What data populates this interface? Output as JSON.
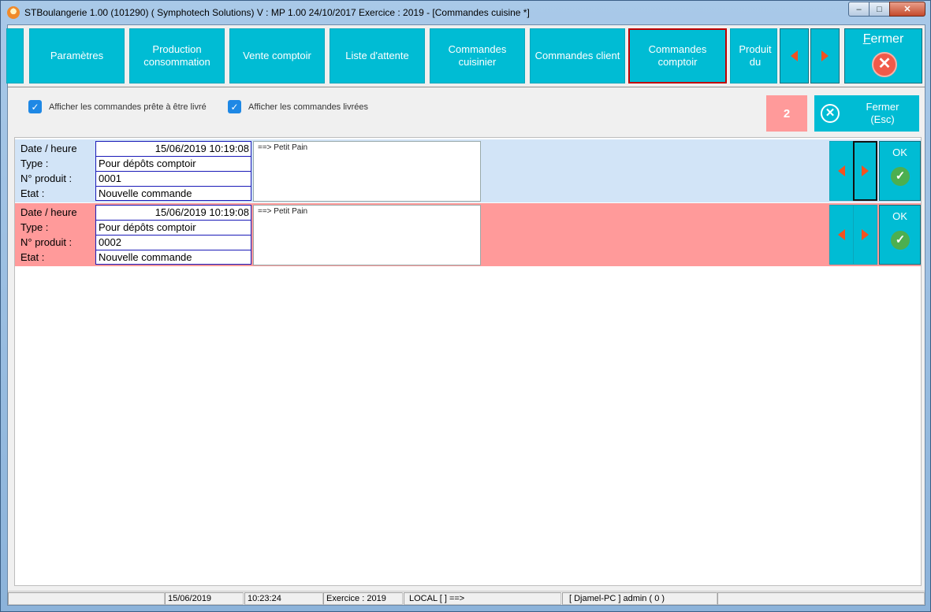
{
  "window": {
    "title": "STBoulangerie 1.00 (101290) ( Symphotech Solutions)  V : MP 1.00 24/10/2017 Exercice : 2019 - [Commandes cuisine  *]",
    "minimize": "–",
    "maximize": "□",
    "close": "✕"
  },
  "toolbar": {
    "buttons": [
      {
        "label": "Paramètres"
      },
      {
        "label": "Production consommation"
      },
      {
        "label": "Vente comptoir"
      },
      {
        "label": "Liste d'attente"
      },
      {
        "label": "Commandes cuisinier"
      },
      {
        "label": "Commandes client"
      },
      {
        "label": "Commandes comptoir"
      },
      {
        "label": "Produit du"
      }
    ],
    "active": "Commandes comptoir",
    "fermer_label": "Fermer",
    "fermer_first": "F",
    "fermer_rest": "ermer"
  },
  "options": {
    "show_ready": {
      "label": "Afficher les commandes prête à être livré",
      "checked": true
    },
    "show_delivered": {
      "label": "Afficher les commandes livrées",
      "checked": true
    }
  },
  "count": "2",
  "close_esc": {
    "label_line1": "Fermer",
    "label_line2": "(Esc)"
  },
  "labels": {
    "date": "Date / heure",
    "type": "Type :",
    "product": "N° produit :",
    "state": "Etat :",
    "ok": "OK"
  },
  "orders": [
    {
      "datetime": "15/06/2019 10:19:08",
      "type": "Pour dépôts comptoir",
      "product_no": "0001",
      "state": "Nouvelle commande",
      "detail": "==> Petit Pain",
      "row_color": "#d2e4f7"
    },
    {
      "datetime": "15/06/2019 10:19:08",
      "type": "Pour dépôts comptoir",
      "product_no": "0002",
      "state": "Nouvelle commande",
      "detail": "==> Petit Pain",
      "row_color": "#ff9a9a"
    }
  ],
  "statusbar": {
    "date": "15/06/2019",
    "time": "10:23:24",
    "exercice": "Exercice : 2019",
    "local": "LOCAL [  ] ==>",
    "user": "[ Djamel-PC ] admin ( 0 )"
  },
  "colors": {
    "accent": "#00bcd4",
    "arrow": "#f4511e",
    "active_border": "#c00000",
    "danger": "#f05a4a",
    "ok": "#4caf50"
  }
}
